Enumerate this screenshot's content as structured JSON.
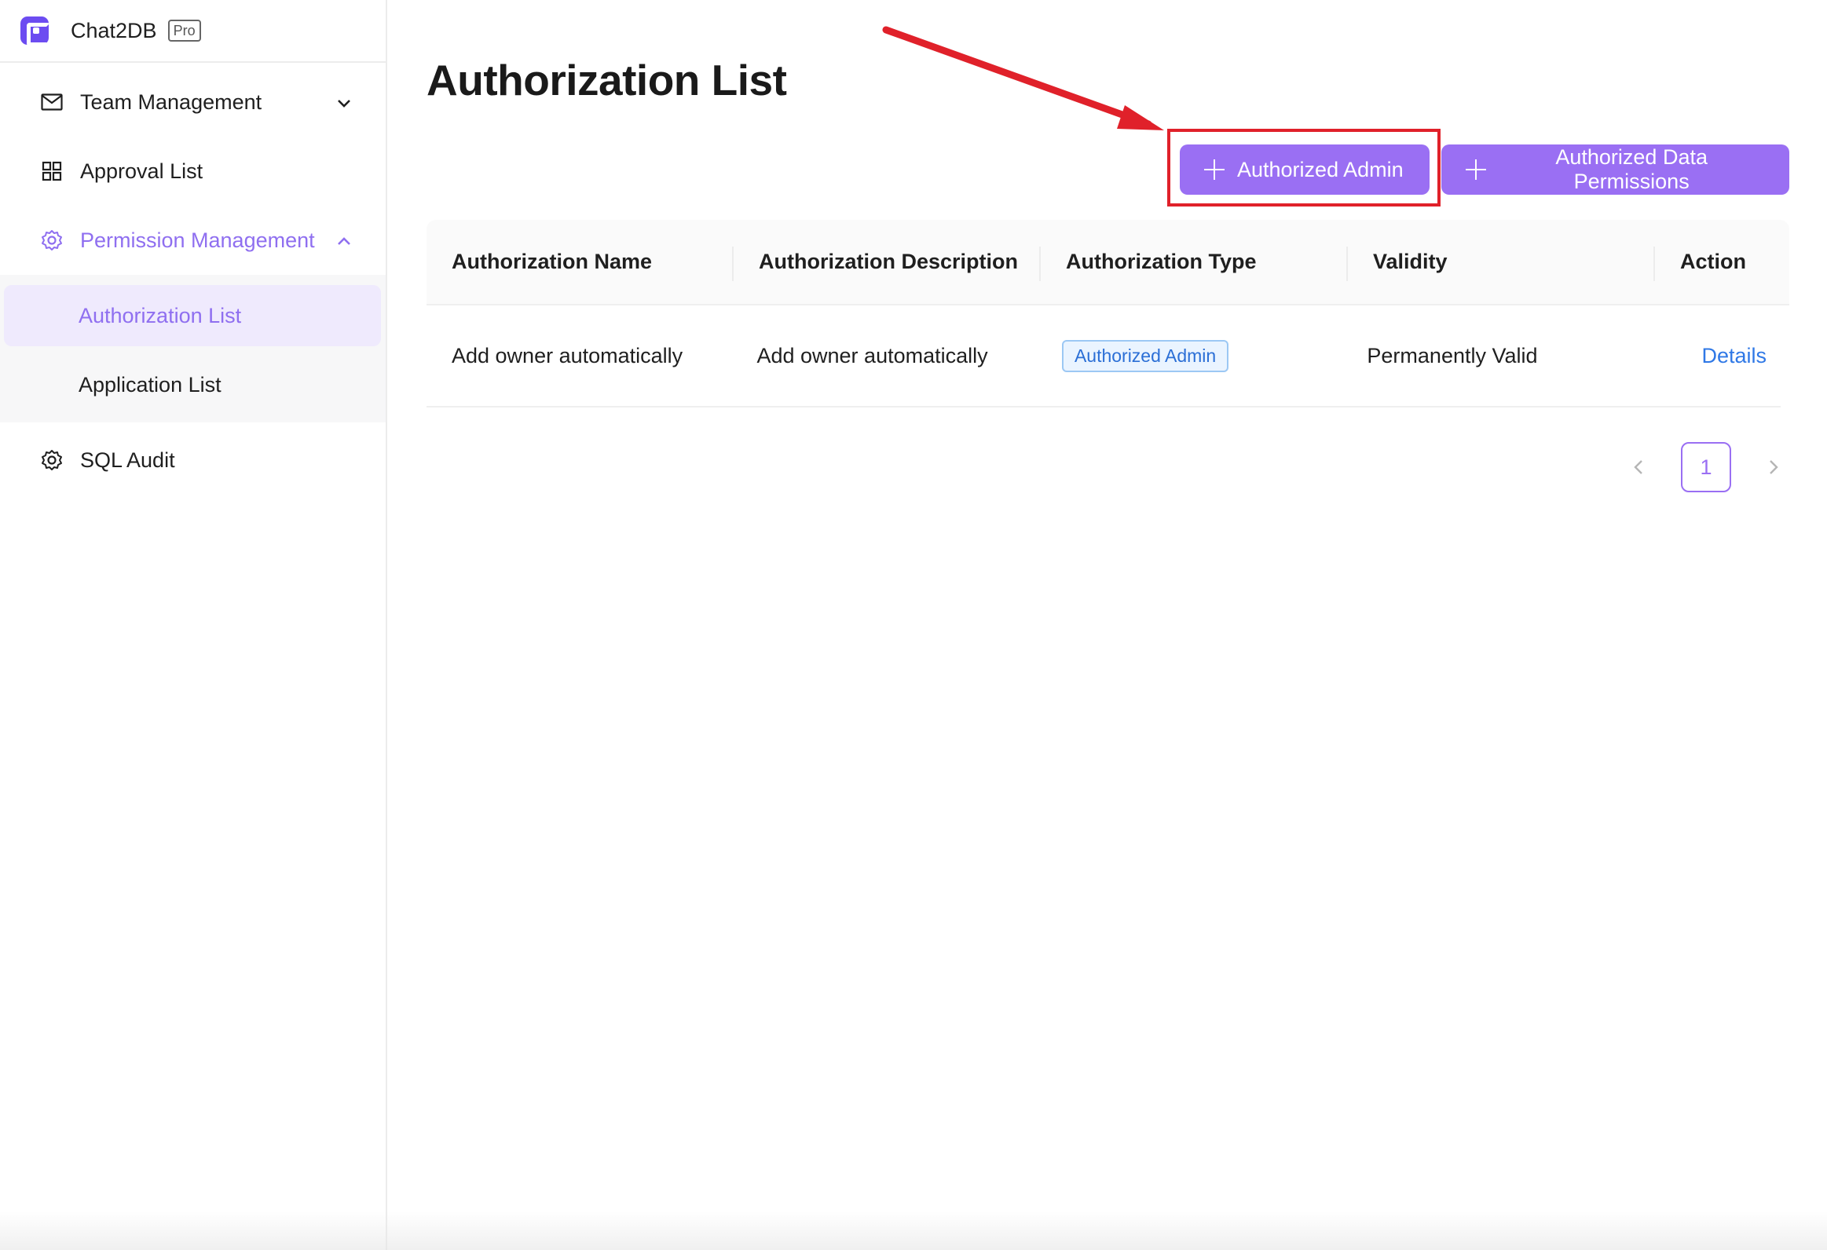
{
  "brand": {
    "name": "Chat2DB",
    "badge": "Pro"
  },
  "sidebar": {
    "items": [
      {
        "label": "Team Management",
        "icon": "mail-icon",
        "chevron": "chevron-down-icon"
      },
      {
        "label": "Approval List",
        "icon": "grid-icon"
      },
      {
        "label": "Permission Management",
        "icon": "gear-icon",
        "chevron": "chevron-up-icon",
        "expanded": true,
        "children": [
          {
            "label": "Authorization List",
            "selected": true
          },
          {
            "label": "Application List"
          }
        ]
      },
      {
        "label": "SQL Audit",
        "icon": "gear-icon"
      }
    ]
  },
  "main": {
    "title": "Authorization List",
    "buttons": {
      "authorized_admin": "Authorized Admin",
      "authorized_data_permissions": "Authorized Data Permissions"
    },
    "table": {
      "columns": [
        "Authorization Name",
        "Authorization Description",
        "Authorization Type",
        "Validity",
        "Action"
      ],
      "rows": [
        {
          "name": "Add owner automatically",
          "description": "Add owner automatically",
          "type": "Authorized Admin",
          "validity": "Permanently Valid",
          "action": "Details"
        }
      ]
    },
    "pagination": {
      "current": "1"
    }
  },
  "colors": {
    "accent": "#9a6ff3",
    "brand": "#6c4cf1",
    "link": "#2f78e6",
    "annotation": "#e0212a"
  }
}
